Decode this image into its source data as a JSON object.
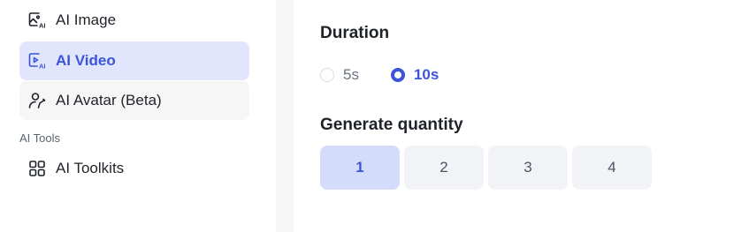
{
  "sidebar": {
    "items": [
      {
        "label": "AI Image",
        "icon": "image-ai-icon"
      },
      {
        "label": "AI Video",
        "icon": "video-ai-icon",
        "active": true
      },
      {
        "label": "AI Avatar (Beta)",
        "icon": "avatar-icon"
      }
    ],
    "section_label": "AI Tools",
    "tools": [
      {
        "label": "AI Toolkits",
        "icon": "grid-icon"
      }
    ]
  },
  "duration": {
    "heading": "Duration",
    "options": [
      {
        "label": "5s",
        "checked": false
      },
      {
        "label": "10s",
        "checked": true
      }
    ]
  },
  "quantity": {
    "heading": "Generate quantity",
    "options": [
      "1",
      "2",
      "3",
      "4"
    ],
    "selected": "1"
  },
  "colors": {
    "accent": "#3b54d9",
    "active_bg": "#e2e6fc",
    "selected_bg": "#d4dcfb",
    "button_bg": "#f1f3f6"
  }
}
